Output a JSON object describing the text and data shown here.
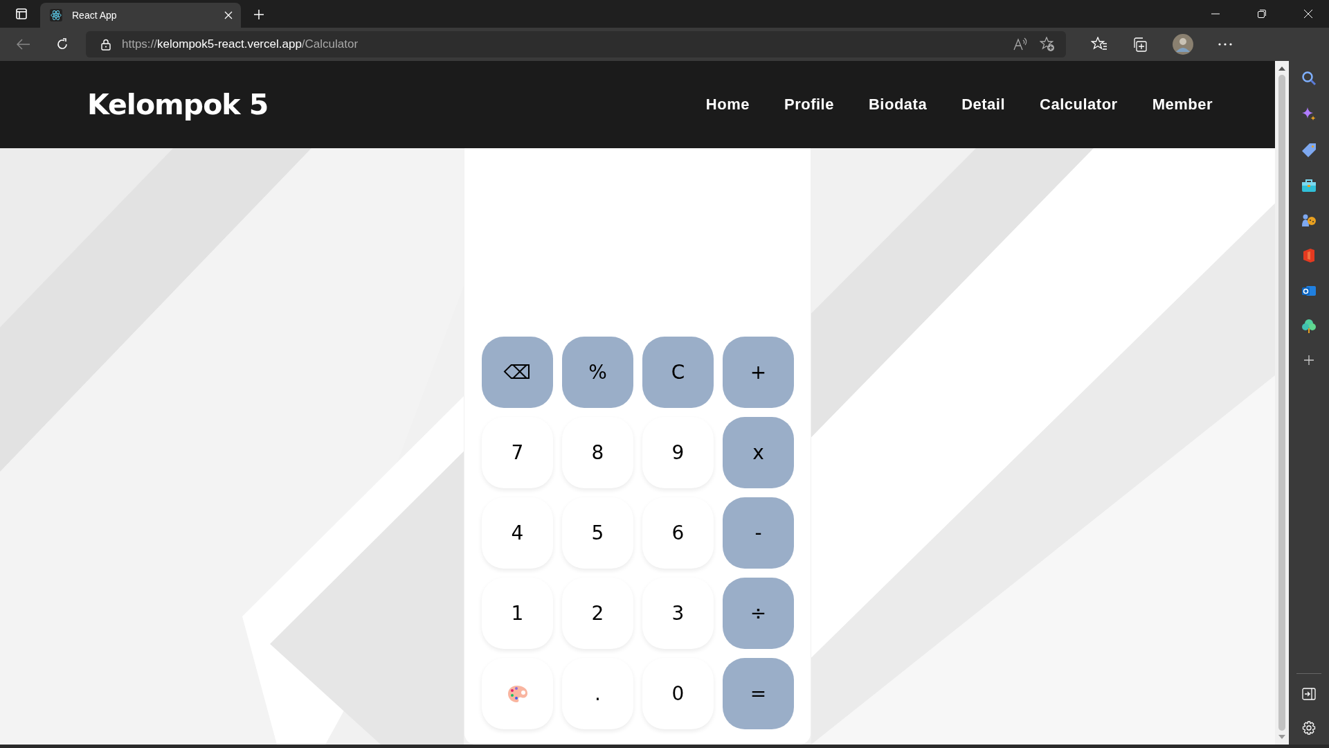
{
  "browser": {
    "tab": {
      "title": "React App",
      "selected": true
    },
    "url": {
      "scheme": "https://",
      "host": "kelompok5-react.vercel.app",
      "path": "/Calculator"
    }
  },
  "header": {
    "title": "Kelompok 5",
    "nav": [
      {
        "label": "Home"
      },
      {
        "label": "Profile"
      },
      {
        "label": "Biodata"
      },
      {
        "label": "Detail"
      },
      {
        "label": "Calculator"
      },
      {
        "label": "Member"
      }
    ]
  },
  "calculator": {
    "keys": [
      {
        "label": "⌫",
        "kind": "operator"
      },
      {
        "label": "%",
        "kind": "operator"
      },
      {
        "label": "C",
        "kind": "operator"
      },
      {
        "label": "+",
        "kind": "operator"
      },
      {
        "label": "7",
        "kind": "digit"
      },
      {
        "label": "8",
        "kind": "digit"
      },
      {
        "label": "9",
        "kind": "digit"
      },
      {
        "label": "x",
        "kind": "operator"
      },
      {
        "label": "4",
        "kind": "digit"
      },
      {
        "label": "5",
        "kind": "digit"
      },
      {
        "label": "6",
        "kind": "digit"
      },
      {
        "label": "-",
        "kind": "operator"
      },
      {
        "label": "1",
        "kind": "digit"
      },
      {
        "label": "2",
        "kind": "digit"
      },
      {
        "label": "3",
        "kind": "digit"
      },
      {
        "label": "÷",
        "kind": "operator"
      },
      {
        "kind": "palette"
      },
      {
        "label": ".",
        "kind": "digit"
      },
      {
        "label": "0",
        "kind": "digit"
      },
      {
        "label": "=",
        "kind": "operator"
      }
    ]
  }
}
